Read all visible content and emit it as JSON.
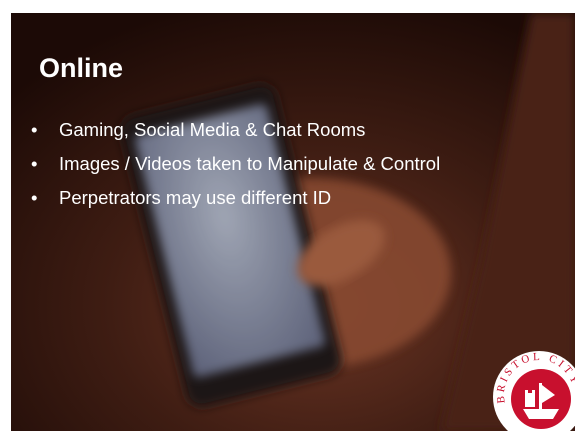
{
  "slide": {
    "title": "Online",
    "bullets": [
      "Gaming, Social Media & Chat Rooms",
      "Images / Videos taken to Manipulate & Control",
      "Perpetrators may use different ID"
    ],
    "bullet_glyph": "•"
  },
  "crest": {
    "icon": "bristol-city-crest-icon",
    "lettering": "BRISTOL CITY"
  },
  "colors": {
    "background": "#2a120c",
    "text": "#ffffff",
    "crest_red": "#c8102e"
  }
}
